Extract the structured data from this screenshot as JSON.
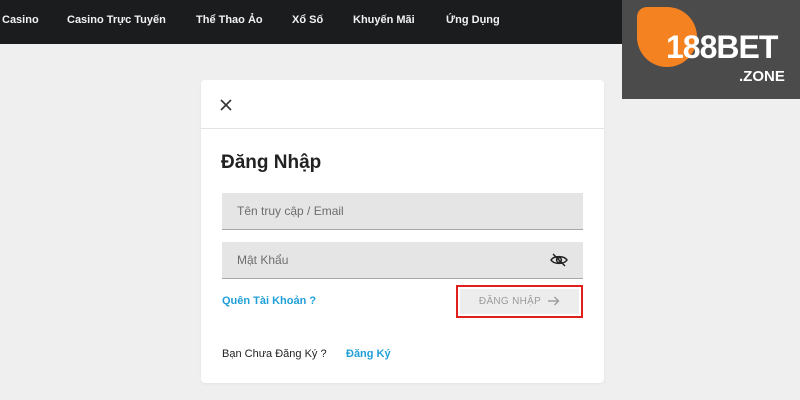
{
  "nav": {
    "items": [
      {
        "label": "Casino"
      },
      {
        "label": "Casino Trực Tuyến"
      },
      {
        "label": "Thể Thao Ảo"
      },
      {
        "label": "Xổ Số"
      },
      {
        "label": "Khuyến Mãi"
      },
      {
        "label": "Ứng Dụng"
      }
    ]
  },
  "logo": {
    "text": "188BET",
    "sub": ".ZONE",
    "brand_color": "#f58220",
    "panel_color": "#4b4b4b"
  },
  "login_modal": {
    "close_icon": "close-icon",
    "title": "Đăng Nhập",
    "username_placeholder": "Tên truy cập / Email",
    "password_placeholder": "Mật Khẩu",
    "password_toggle_icon": "eye-slash-icon",
    "forgot_label": "Quên Tài Khoản ?",
    "login_button_label": "ĐĂNG NHẬP",
    "login_button_icon": "arrow-right-icon",
    "highlight_color": "#e0201c",
    "not_registered_text": "Bạn Chưa Đăng Ký ?",
    "register_label": "Đăng Ký",
    "link_color": "#1f9fd8"
  }
}
